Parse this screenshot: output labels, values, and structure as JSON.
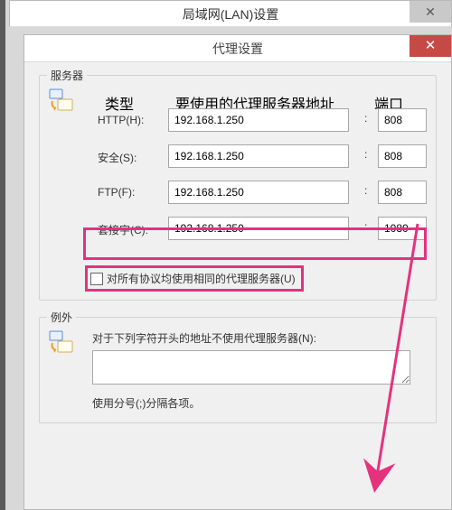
{
  "parent_window": {
    "title": "局域网(LAN)设置",
    "close_glyph": "✕"
  },
  "dialog": {
    "title": "代理设置",
    "close_glyph": "✕"
  },
  "servers_group": {
    "label": "服务器",
    "headers": {
      "type": "类型",
      "addr": "要使用的代理服务器地址",
      "port": "端口"
    },
    "rows": [
      {
        "label": "HTTP(H):",
        "addr": "192.168.1.250",
        "port": "808"
      },
      {
        "label": "安全(S):",
        "addr": "192.168.1.250",
        "port": "808"
      },
      {
        "label": "FTP(F):",
        "addr": "192.168.1.250",
        "port": "808"
      },
      {
        "label": "套接字(C):",
        "addr": "192.168.1.250",
        "port": "1080"
      }
    ],
    "colon": ":",
    "same_for_all_label": "对所有协议均使用相同的代理服务器(U)"
  },
  "exceptions_group": {
    "label": "例外",
    "text": "对于下列字符开头的地址不使用代理服务器(N):",
    "list_value": "",
    "hint": "使用分号(;)分隔各项。"
  },
  "colors": {
    "highlight": "#e5317e",
    "close_red": "#c54a46"
  }
}
